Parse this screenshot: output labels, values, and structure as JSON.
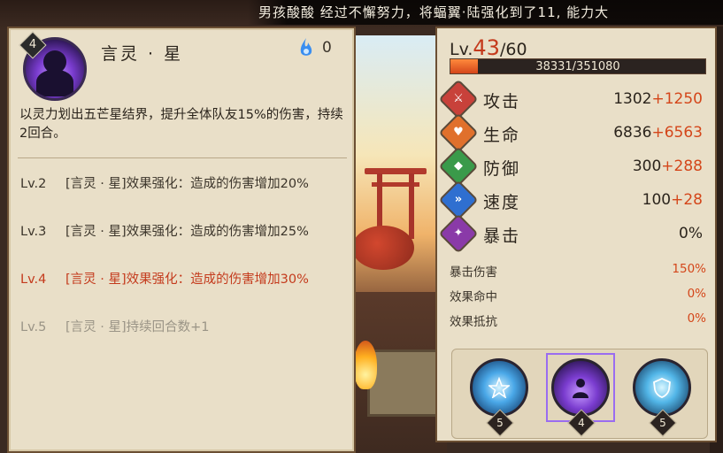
{
  "banner": {
    "text": "男孩酸酸 经过不懈努力，将蝠翼·陆强化到了11, 能力大"
  },
  "skill": {
    "level_badge": "4",
    "name": "言灵 · 星",
    "orb_count": "0",
    "description": "以灵力划出五芒星结界，提升全体队友15%的伤害，持续2回合。",
    "levels": [
      {
        "lv": "Lv.2",
        "text": "[言灵 · 星]效果强化：造成的伤害增加20%",
        "state": "normal"
      },
      {
        "lv": "Lv.3",
        "text": "[言灵 · 星]效果强化：造成的伤害增加25%",
        "state": "normal"
      },
      {
        "lv": "Lv.4",
        "text": "[言灵 · 星]效果强化：造成的伤害增加30%",
        "state": "current"
      },
      {
        "lv": "Lv.5",
        "text": "[言灵 · 星]持续回合数+1",
        "state": "locked"
      }
    ]
  },
  "stats": {
    "level_prefix": "Lv.",
    "level_current": "43",
    "level_max": "/60",
    "xp_text": "38331/351080",
    "xp_fraction": 0.109,
    "rows": [
      {
        "name": "攻击",
        "base": "1302",
        "bonus": "+1250",
        "icon": "attack-icon",
        "color": "#c8413a"
      },
      {
        "name": "生命",
        "base": "6836",
        "bonus": "+6563",
        "icon": "health-icon",
        "color": "#e0702c"
      },
      {
        "name": "防御",
        "base": "300",
        "bonus": "+288",
        "icon": "defense-icon",
        "color": "#3a9a4a"
      },
      {
        "name": "速度",
        "base": "100",
        "bonus": "+28",
        "icon": "speed-icon",
        "color": "#2f6fd0"
      },
      {
        "name": "暴击",
        "base": "0%",
        "bonus": "",
        "icon": "crit-icon",
        "color": "#8a3aa8"
      }
    ],
    "sub_rows": [
      {
        "name": "暴击伤害",
        "value": "150%"
      },
      {
        "name": "效果命中",
        "value": "0%"
      },
      {
        "name": "效果抵抗",
        "value": "0%"
      }
    ]
  },
  "tray": [
    {
      "name": "skill-1",
      "level": "5",
      "icon": "pentagram-scroll-icon"
    },
    {
      "name": "skill-2",
      "level": "4",
      "icon": "silhouette-icon"
    },
    {
      "name": "skill-3",
      "level": "5",
      "icon": "shield-icon"
    }
  ]
}
